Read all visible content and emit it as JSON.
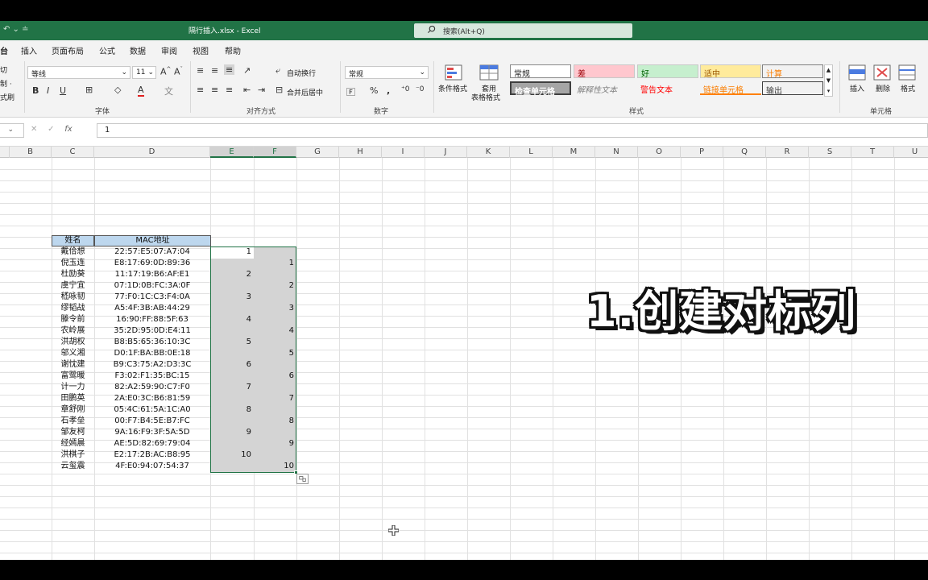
{
  "window": {
    "title": "隔行插入.xlsx  -  Excel",
    "search_placeholder": "搜索(Alt+Q)"
  },
  "tabs": [
    "插入",
    "页面布局",
    "公式",
    "数据",
    "审阅",
    "视图",
    "帮助"
  ],
  "tab_partial": "台",
  "ribbon": {
    "clipboard_partial": [
      "切",
      "制 ·",
      "式刷"
    ],
    "font_name": "等线",
    "font_size": "11",
    "font_group": "字体",
    "align_group": "对齐方式",
    "wrap_text": "自动换行",
    "merge_center": "合并后居中",
    "number_format": "常规",
    "number_group": "数字",
    "cond_format": "条件格式",
    "table_format_1": "套用",
    "table_format_2": "表格格式",
    "styles": {
      "normal": "常规",
      "bad": "差",
      "good": "好",
      "neutral": "适中",
      "calc": "计算",
      "check_cell": "检查单元格",
      "explanatory": "解释性文本",
      "warning": "警告文本",
      "linked_cell": "链接单元格",
      "output": "输出"
    },
    "styles_group": "样式",
    "insert": "插入",
    "delete": "删除",
    "format": "格式",
    "cells_group": "单元格"
  },
  "formula_bar": {
    "value": "1"
  },
  "columns": [
    "B",
    "C",
    "D",
    "E",
    "F",
    "G",
    "H",
    "I",
    "J",
    "K",
    "L",
    "M",
    "N",
    "O",
    "P",
    "Q",
    "R",
    "S",
    "T",
    "U"
  ],
  "table": {
    "headers": [
      "姓名",
      "MAC地址"
    ],
    "rows": [
      [
        "戴佮想",
        "22:57:E5:07:A7:04"
      ],
      [
        "倪玉连",
        "E8:17:69:0D:89:36"
      ],
      [
        "杜励葵",
        "11:17:19:B6:AF:E1"
      ],
      [
        "虞宁宜",
        "07:1D:0B:FC:3A:0F"
      ],
      [
        "嵇咏韧",
        "77:F0:1C:C3:F4:0A"
      ],
      [
        "缪韬战",
        "A5:4F:3B:AB:44:29"
      ],
      [
        "滕令前",
        "16:90:FF:88:5F:63"
      ],
      [
        "农岭展",
        "35:2D:95:0D:E4:11"
      ],
      [
        "洪胡权",
        "B8:B5:65:36:10:3C"
      ],
      [
        "邬义湘",
        "D0:1F:BA:BB:0E:18"
      ],
      [
        "谢忱建",
        "B9:C3:75:A2:D3:3C"
      ],
      [
        "富鹭暖",
        "F3:02:F1:35:BC:15"
      ],
      [
        "计一力",
        "82:A2:59:90:C7:F0"
      ],
      [
        "田鹏英",
        "2A:E0:3C:B6:81:59"
      ],
      [
        "章舒刚",
        "05:4C:61:5A:1C:A0"
      ],
      [
        "石孝垒",
        "00:F7:B4:5E:B7:FC"
      ],
      [
        "邹友柯",
        "9A:16:F9:3F:5A:5D"
      ],
      [
        "经嫣晨",
        "AE:5D:82:69:79:04"
      ],
      [
        "洪棋子",
        "E2:17:2B:AC:B8:95"
      ],
      [
        "云玺震",
        "4F:E0:94:07:54:37"
      ]
    ]
  },
  "col_e": [
    "1",
    "",
    "2",
    "",
    "3",
    "",
    "4",
    "",
    "5",
    "",
    "6",
    "",
    "7",
    "",
    "8",
    "",
    "9",
    "",
    "10",
    ""
  ],
  "col_f": [
    "",
    "1",
    "",
    "2",
    "",
    "3",
    "",
    "4",
    "",
    "5",
    "",
    "6",
    "",
    "7",
    "",
    "8",
    "",
    "9",
    "",
    "10"
  ],
  "overlay_text": "1.创建对标列",
  "colors": {
    "excel_green": "#217346",
    "header_fill": "#bdd7ee",
    "selection_fill": "#d4d4d4"
  }
}
